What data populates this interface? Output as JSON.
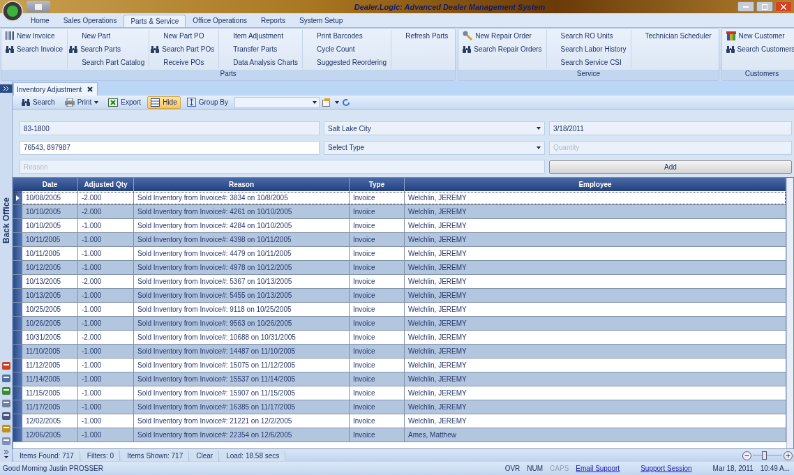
{
  "window": {
    "title": "Dealer.Logic: Advanced Dealer Management System"
  },
  "ribbon_tabs": [
    {
      "label": "Home",
      "selected": false
    },
    {
      "label": "Sales Operations",
      "selected": false
    },
    {
      "label": "Parts & Service",
      "selected": true
    },
    {
      "label": "Office Operations",
      "selected": false
    },
    {
      "label": "Reports",
      "selected": false
    },
    {
      "label": "System Setup",
      "selected": false
    }
  ],
  "ribbon_groups": [
    {
      "label": "Parts",
      "columns": [
        [
          {
            "label": "New Invoice",
            "kind": "barcode"
          },
          {
            "label": "Search Invoice",
            "kind": "search"
          }
        ],
        [
          {
            "label": "New Part",
            "kind": "plain"
          },
          {
            "label": "Search Parts",
            "kind": "search"
          },
          {
            "label": "Search Part Catalog",
            "kind": "plain"
          }
        ],
        [
          {
            "label": "New Part PO",
            "kind": "plain"
          },
          {
            "label": "Search Part POs",
            "kind": "search"
          },
          {
            "label": "Receive POs",
            "kind": "plain"
          }
        ],
        [
          {
            "label": "Item Adjustment",
            "kind": "plain"
          },
          {
            "label": "Transfer Parts",
            "kind": "plain"
          },
          {
            "label": "Data Analysis Charts",
            "kind": "plain"
          }
        ],
        [
          {
            "label": "Print Barcodes",
            "kind": "plain"
          },
          {
            "label": "Cycle Count",
            "kind": "plain"
          },
          {
            "label": "Suggested Reordering",
            "kind": "plain"
          }
        ],
        [
          {
            "label": "Refresh Parts",
            "kind": "plain"
          }
        ]
      ]
    },
    {
      "label": "Service",
      "columns": [
        [
          {
            "label": "New Repair Order",
            "kind": "wrench"
          },
          {
            "label": "Search Repair Orders",
            "kind": "search"
          }
        ],
        [
          {
            "label": "Search RO Units",
            "kind": "plain"
          },
          {
            "label": "Search Labor History",
            "kind": "plain"
          },
          {
            "label": "Search Service CSI",
            "kind": "plain"
          }
        ],
        [
          {
            "label": "Technician Scheduler",
            "kind": "plain"
          }
        ]
      ]
    },
    {
      "label": "Customers",
      "columns": [
        [
          {
            "label": "New Customer",
            "kind": "people"
          },
          {
            "label": "Search Customers",
            "kind": "search"
          }
        ]
      ]
    }
  ],
  "sidebar": {
    "label": "Back Office"
  },
  "document_tabs": [
    {
      "label": "Inventory Adjustment",
      "selected": true
    }
  ],
  "toolbar": [
    {
      "label": "Search",
      "kind": "search",
      "selected": false
    },
    {
      "label": "Print",
      "kind": "print",
      "selected": false
    },
    {
      "label": "Export",
      "kind": "export",
      "selected": false
    },
    {
      "label": "Hide",
      "kind": "hide",
      "selected": true
    },
    {
      "label": "Group By",
      "kind": "group",
      "selected": false
    }
  ],
  "form": {
    "part_number": {
      "value": "83-1800"
    },
    "location": {
      "value": "Salt Lake City"
    },
    "date": {
      "value": "3/18/2011"
    },
    "invoices": {
      "value": "76543, 897987"
    },
    "type": {
      "value": "Select Type"
    },
    "quantity": {
      "placeholder": "Quantity"
    },
    "reason": {
      "placeholder": "Reason"
    },
    "add_button": "Add"
  },
  "table": {
    "columns": [
      "Date",
      "Adjusted Qty",
      "Reason",
      "Type",
      "Employee"
    ],
    "rows": [
      {
        "selected": true,
        "cells": [
          "10/08/2005",
          "-2.000",
          "Sold Inventory from Invoice#: 3834 on 10/8/2005",
          "Invoice",
          "Welchlin, JEREMY"
        ]
      },
      {
        "selected": false,
        "cells": [
          "10/10/2005",
          "-2.000",
          "Sold Inventory from Invoice#: 4261 on 10/10/2005",
          "Invoice",
          "Welchlin, JEREMY"
        ]
      },
      {
        "selected": false,
        "cells": [
          "10/10/2005",
          "-1.000",
          "Sold Inventory from Invoice#: 4284 on 10/10/2005",
          "Invoice",
          "Welchlin, JEREMY"
        ]
      },
      {
        "selected": false,
        "cells": [
          "10/11/2005",
          "-1.000",
          "Sold Inventory from Invoice#: 4398 on 10/11/2005",
          "Invoice",
          "Welchlin, JEREMY"
        ]
      },
      {
        "selected": false,
        "cells": [
          "10/11/2005",
          "-1.000",
          "Sold Inventory from Invoice#: 4479 on 10/11/2005",
          "Invoice",
          "Welchlin, JEREMY"
        ]
      },
      {
        "selected": false,
        "cells": [
          "10/12/2005",
          "-1.000",
          "Sold Inventory from Invoice#: 4978 on 10/12/2005",
          "Invoice",
          "Welchlin, JEREMY"
        ]
      },
      {
        "selected": false,
        "cells": [
          "10/13/2005",
          "-2.000",
          "Sold Inventory from Invoice#: 5367 on 10/13/2005",
          "Invoice",
          "Welchlin, JEREMY"
        ]
      },
      {
        "selected": false,
        "cells": [
          "10/13/2005",
          "-1.000",
          "Sold Inventory from Invoice#: 5455 on 10/13/2005",
          "Invoice",
          "Welchlin, JEREMY"
        ]
      },
      {
        "selected": false,
        "cells": [
          "10/25/2005",
          "-1.000",
          "Sold Inventory from Invoice#: 9118 on 10/25/2005",
          "Invoice",
          "Welchlin, JEREMY"
        ]
      },
      {
        "selected": false,
        "cells": [
          "10/26/2005",
          "-1.000",
          "Sold Inventory from Invoice#: 9563 on 10/26/2005",
          "Invoice",
          "Welchlin, JEREMY"
        ]
      },
      {
        "selected": false,
        "cells": [
          "10/31/2005",
          "-2.000",
          "Sold Inventory from Invoice#: 10688 on 10/31/2005",
          "Invoice",
          "Welchlin, JEREMY"
        ]
      },
      {
        "selected": false,
        "cells": [
          "11/10/2005",
          "-1.000",
          "Sold Inventory from Invoice#: 14487 on 11/10/2005",
          "Invoice",
          "Welchlin, JEREMY"
        ]
      },
      {
        "selected": false,
        "cells": [
          "11/12/2005",
          "-1.000",
          "Sold Inventory from Invoice#: 15075 on 11/12/2005",
          "Invoice",
          "Welchlin, JEREMY"
        ]
      },
      {
        "selected": false,
        "cells": [
          "11/14/2005",
          "-1.000",
          "Sold Inventory from Invoice#: 15537 on 11/14/2005",
          "Invoice",
          "Welchlin, JEREMY"
        ]
      },
      {
        "selected": false,
        "cells": [
          "11/15/2005",
          "-1.000",
          "Sold Inventory from Invoice#: 15907 on 11/15/2005",
          "Invoice",
          "Welchlin, JEREMY"
        ]
      },
      {
        "selected": false,
        "cells": [
          "11/17/2005",
          "-1.000",
          "Sold Inventory from Invoice#: 16385 on 11/17/2005",
          "Invoice",
          "Welchlin, JEREMY"
        ]
      },
      {
        "selected": false,
        "cells": [
          "12/02/2005",
          "-1.000",
          "Sold Inventory from Invoice#: 21221 on 12/2/2005",
          "Invoice",
          "Welchlin, JEREMY"
        ]
      },
      {
        "selected": false,
        "cells": [
          "12/06/2005",
          "-1.000",
          "Sold Inventory from Invoice#: 22354 on 12/6/2005",
          "Invoice",
          "Ames, Matthew"
        ]
      }
    ]
  },
  "grid_footer": {
    "items": [
      "Items Found: 717",
      "Filters: 0",
      "Items Shown: 717",
      "Clear",
      "Load: 18.58 secs"
    ],
    "zoom": {
      "level": 0.4
    }
  },
  "status_bar": {
    "greeting": "Good Morning Justin PROSSER",
    "indicators": [
      {
        "label": "OVR",
        "disabled": false
      },
      {
        "label": "NUM",
        "disabled": false
      },
      {
        "label": "CAPS",
        "disabled": true
      }
    ],
    "links": [
      "Email Support",
      "Support Session"
    ],
    "date": "Mar 18, 2011",
    "time": "10:49 A..."
  }
}
